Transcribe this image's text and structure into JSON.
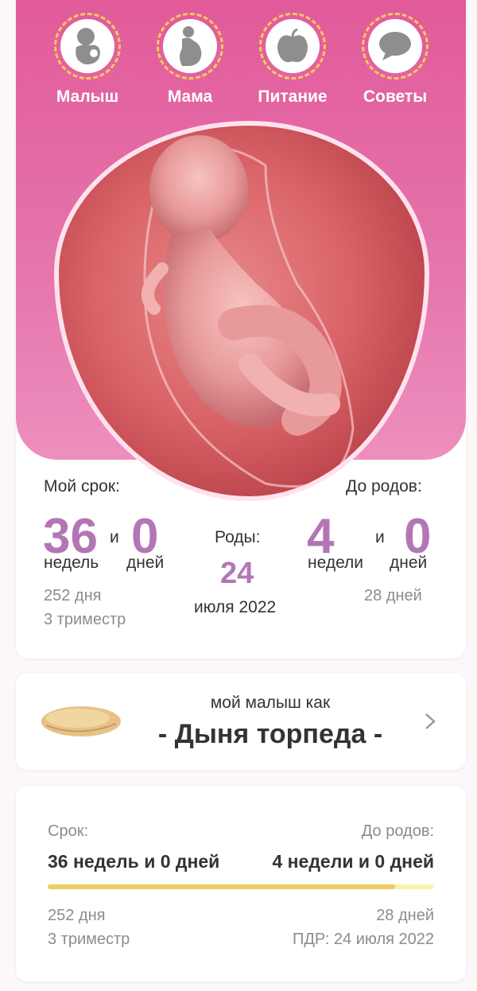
{
  "nav": {
    "items": [
      {
        "label": "Малыш",
        "icon": "baby-icon"
      },
      {
        "label": "Мама",
        "icon": "pregnant-mother-icon"
      },
      {
        "label": "Питание",
        "icon": "apple-icon"
      },
      {
        "label": "Советы",
        "icon": "speech-bubble-icon"
      }
    ]
  },
  "status": {
    "my_term_label": "Мой срок:",
    "weeks": "36",
    "and": "и",
    "days": "0",
    "weeks_unit": "недель",
    "days_unit": "дней",
    "total_days": "252 дня",
    "trimester": "3 триместр",
    "birth_label": "Роды:",
    "birth_day": "24",
    "birth_month_year": "июля 2022",
    "until_label": "До родов:",
    "until_weeks": "4",
    "until_days": "0",
    "until_weeks_unit": "недели",
    "until_days_unit": "дней",
    "until_total_days": "28 дней"
  },
  "fruit": {
    "caption": "мой малыш как",
    "name": "- Дыня торпеда -",
    "icon": "chevron-right-icon"
  },
  "summary": {
    "term_label": "Срок:",
    "until_label": "До родов:",
    "term_value": "36 недель и 0 дней",
    "until_value": "4 недели и 0 дней",
    "progress": 0.9,
    "days": "252 дня",
    "trimester": "3 триместр",
    "until_days": "28 дней",
    "due_date": "ПДР: 24 июля 2022"
  },
  "colors": {
    "accent_pink": "#e25a9a",
    "number_purple": "#b276b5",
    "progress_yellow": "#eccd5e"
  }
}
